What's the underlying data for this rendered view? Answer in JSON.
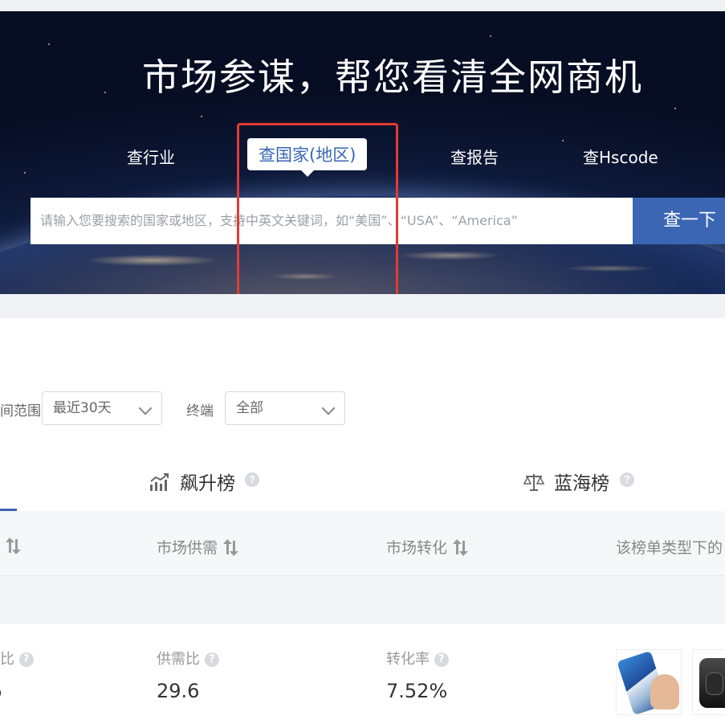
{
  "hero": {
    "title": "市场参谋，帮您看清全网商机",
    "tabs": [
      {
        "label": "查行业"
      },
      {
        "label": "查国家(地区)",
        "active": true
      },
      {
        "label": "查报告"
      },
      {
        "label": "查Hscode"
      }
    ],
    "search": {
      "placeholder": "请输入您要搜索的国家或地区，支持中英文关键词，如“美国”、“USA”、“America”",
      "button_label": "查一下"
    }
  },
  "filters": {
    "range_label": "间范围",
    "range_value": "最近30天",
    "terminal_label": "终端",
    "terminal_value": "全部"
  },
  "rank_tabs": [
    {
      "label": "飙升榜",
      "icon": "trending-chart-icon"
    },
    {
      "label": "蓝海榜",
      "icon": "balance-scale-icon"
    }
  ],
  "table_headers": [
    "市场供需",
    "市场转化",
    "该榜单类型下的"
  ],
  "metrics": [
    {
      "label": "比",
      "value": ""
    },
    {
      "label": "供需比",
      "value": "29.6"
    },
    {
      "label": "转化率",
      "value": "7.52%"
    }
  ],
  "thumbnails": [
    "phone-product-image",
    "earbuds-case-image"
  ],
  "colors": {
    "accent": "#3a66b3",
    "highlight_box": "#e33b32"
  }
}
